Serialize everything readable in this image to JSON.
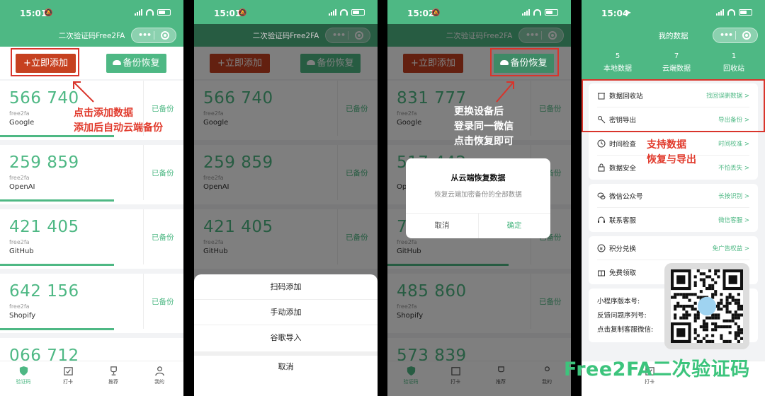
{
  "status_times": [
    "15:01",
    "15:01",
    "15:02",
    "15:04"
  ],
  "app_title": "二次验证码Free2FA",
  "buttons": {
    "add": "+立即添加",
    "restore": "备份恢复"
  },
  "codes_p1": [
    {
      "code": "566 740",
      "account": "free2fa",
      "issuer": "Google",
      "status": "已备份",
      "progress": 0.62
    },
    {
      "code": "259 859",
      "account": "free2fa",
      "issuer": "OpenAI",
      "status": "已备份",
      "progress": 0.62
    },
    {
      "code": "421 405",
      "account": "free2fa",
      "issuer": "GitHub",
      "status": "已备份",
      "progress": 0.62
    },
    {
      "code": "642 156",
      "account": "free2fa",
      "issuer": "Shopify",
      "status": "已备份",
      "progress": 0.62
    },
    {
      "code": "066 712",
      "account": "",
      "issuer": "",
      "status": "",
      "progress": 0
    }
  ],
  "codes_p2": [
    {
      "code": "566 740",
      "account": "free2fa",
      "issuer": "Google",
      "status": "已备份"
    },
    {
      "code": "259 859",
      "account": "free2fa",
      "issuer": "OpenAI",
      "status": "已备份"
    },
    {
      "code": "421 405",
      "account": "free2fa",
      "issuer": "GitHub",
      "status": "已备份"
    }
  ],
  "codes_p3": [
    {
      "code": "831 777",
      "account": "free2fa",
      "issuer": "Google",
      "status": "已备份"
    },
    {
      "code": "517 442",
      "account": "",
      "issuer": "Op",
      "status": "已备份"
    },
    {
      "code": "7",
      "account": "free2fa",
      "issuer": "GitHub",
      "status": "已备份"
    },
    {
      "code": "485 860",
      "account": "free2fa",
      "issuer": "Shopify",
      "status": "已备份"
    },
    {
      "code": "573 839",
      "account": "",
      "issuer": "",
      "status": ""
    }
  ],
  "tabs": [
    "验证码",
    "打卡",
    "推荐",
    "我的"
  ],
  "sheet": {
    "scan": "扫码添加",
    "manual": "手动添加",
    "google": "谷歌导入",
    "cancel": "取消"
  },
  "dialog": {
    "title": "从云端恢复数据",
    "message": "恢复云端加密备份的全部数据",
    "cancel": "取消",
    "confirm": "确定"
  },
  "annotations": {
    "p1_line1": "点击添加数据",
    "p1_line2": "添加后自动云端备份",
    "p3_line1": "更换设备后",
    "p3_line2": "登录同一微信",
    "p3_line3": "点击恢复即可",
    "p4_line1": "支持数据",
    "p4_line2": "恢复与导出"
  },
  "my_data": {
    "title": "我的数据",
    "stats": [
      {
        "num": "5",
        "label": "本地数据"
      },
      {
        "num": "7",
        "label": "云端数据"
      },
      {
        "num": "1",
        "label": "回收站"
      }
    ],
    "group1": [
      {
        "icon": "recycle-bin-icon",
        "label": "数据回收站",
        "value": "找回误删数据 >"
      },
      {
        "icon": "key-icon",
        "label": "密钥导出",
        "value": "导出备份 >"
      },
      {
        "icon": "clock-icon",
        "label": "时间检查",
        "value": "时间校准 >"
      },
      {
        "icon": "lock-icon",
        "label": "数据安全",
        "value": "不怕丢失 >"
      }
    ],
    "group2": [
      {
        "icon": "wechat-icon",
        "label": "微信公众号",
        "value": "长按识别 >"
      },
      {
        "icon": "headset-icon",
        "label": "联系客服",
        "value": "微信客服 >"
      }
    ],
    "group3": [
      {
        "icon": "points-icon",
        "label": "积分兑换",
        "value": "免广告权益 >"
      },
      {
        "icon": "gift-icon",
        "label": "免费领取",
        "value": ""
      }
    ],
    "info": [
      "小程序版本号:",
      "反馈问题序列号:",
      "点击复制客服微信:"
    ]
  },
  "watermark": "Free2FA二次验证码",
  "colors": {
    "accent": "#4eb884",
    "add_button": "#c64120",
    "annotation": "#e13a2c"
  }
}
